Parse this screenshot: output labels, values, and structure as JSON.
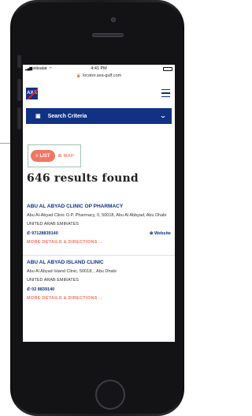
{
  "status": {
    "carrier": "etisalat",
    "time": "4:41 PM",
    "url": "locator.axa-gulf.com"
  },
  "header": {
    "logo_text": "AXA"
  },
  "search": {
    "label": "Search Criteria"
  },
  "view_toggle": {
    "list_label": "LIST",
    "map_label": "MAP"
  },
  "results_heading": "646 results found",
  "results": [
    {
      "name": "ABU AL ABYAD CLINIC OP PHARMACY",
      "address": "Abu Al-Abyad Clinic O.P. Pharmacy, 0, 50018, Abu Al Abbyad, Abu Dhabi",
      "country": "UNITED ARAB EMIRATES",
      "phone": "97128839140",
      "website_label": "Website",
      "details_label": "MORE DETAILS & DIRECTIONS"
    },
    {
      "name": "ABU AL ABYAD ISLAND CLINIC",
      "address": "Abu Al Abyad Island Clinic, 50018, , Abu Dhabi",
      "country": "UNITED ARAB EMIRATES",
      "phone": "02 8839140",
      "details_label": "MORE DETAILS & DIRECTIONS"
    }
  ],
  "colors": {
    "brand_blue": "#103184",
    "accent_coral": "#f07662",
    "axa_red": "#ff1721"
  }
}
